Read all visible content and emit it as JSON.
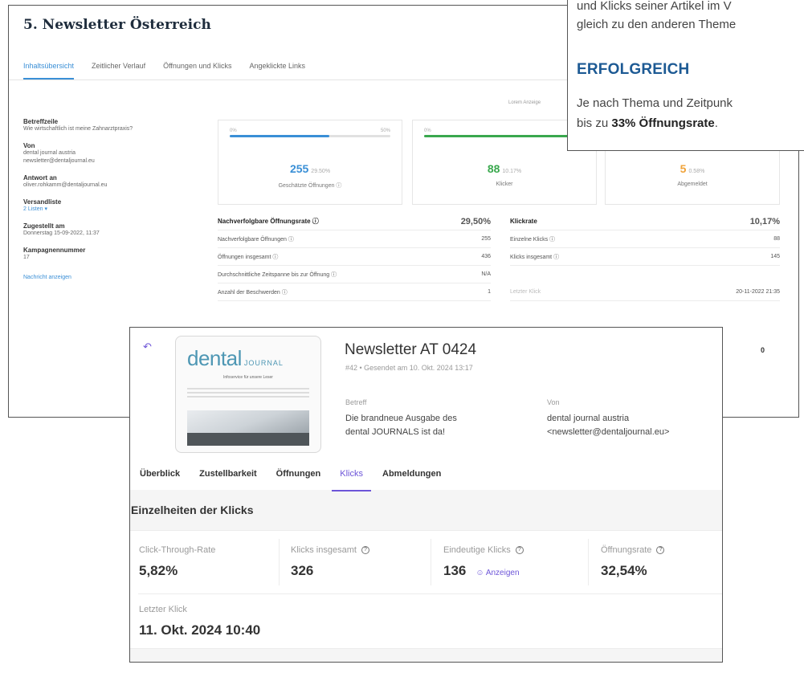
{
  "back_window": {
    "title": "5. Newsletter Österreich",
    "tabs": [
      "Inhaltsübersicht",
      "Zeitlicher Verlauf",
      "Öffnungen und Klicks",
      "Angeklickte Links"
    ],
    "top_link": "Lorem Anzeige",
    "sidebar": [
      {
        "label": "Betreffzeile",
        "value": "Wie wirtschaftlich ist meine Zahnarztpraxis?"
      },
      {
        "label": "Von",
        "value": "dental journal austria\nnewsletter@dentaljournal.eu"
      },
      {
        "label": "Antwort an",
        "value": "oliver.rohkamm@dentaljournal.eu"
      },
      {
        "label": "Versandliste",
        "value": "2 Listen ▾"
      },
      {
        "label": "Zugestellt am",
        "value": "Donnerstag 15-09-2022, 11:37"
      },
      {
        "label": "Kampagnennummer",
        "value": "17"
      }
    ],
    "sidebar_link": "Nachricht anzeigen",
    "stats": [
      {
        "value": "255",
        "pct": "29.50%",
        "caption": "Geschätzte Öffnungen ⓘ",
        "bar_start": "0%",
        "bar_end": "50%",
        "fill": 0.62,
        "color": "#3a8fd6"
      },
      {
        "value": "88",
        "pct": "10.17%",
        "caption": "Klicker",
        "bar_start": "0%",
        "bar_end": "",
        "fill": 1.0,
        "color": "#3aa84e"
      },
      {
        "value": "5",
        "pct": "0.58%",
        "caption": "Abgemeldet",
        "bar_start": "",
        "bar_end": "",
        "fill": 0,
        "color": "#f0a33a"
      }
    ],
    "open_table": {
      "header_label": "Nachverfolgbare Öffnungsrate ⓘ",
      "header_value": "29,50%",
      "rows": [
        {
          "label": "Nachverfolgbare Öffnungen ⓘ",
          "value": "255"
        },
        {
          "label": "Öffnungen insgesamt ⓘ",
          "value": "436"
        },
        {
          "label": "Durchschnittliche Zeitspanne bis zur Öffnung ⓘ",
          "value": "N/A"
        },
        {
          "label": "Anzahl der Beschwerden ⓘ",
          "value": "1"
        }
      ]
    },
    "click_table": {
      "header_label": "Klickrate",
      "header_value": "10,17%",
      "rows": [
        {
          "label": "Einzelne Klicks ⓘ",
          "value": "88"
        },
        {
          "label": "Klicks insgesamt ⓘ",
          "value": "145"
        },
        {
          "label": "",
          "value": ""
        },
        {
          "label": "Letzter Klick",
          "value": "20-11-2022 21:35"
        }
      ],
      "extra_value": "0"
    }
  },
  "article": {
    "line1": "und Klicks seiner Artikel im V",
    "line2": "gleich zu den anderen Theme",
    "heading": "ERFOLGREICH",
    "line3": "Je nach Thema und Zeitpunk",
    "line4_prefix": "bis zu ",
    "line4_bold": "33% Öffnungsrate",
    "line4_suffix": "."
  },
  "front_window": {
    "back_icon": "↶",
    "thumbnail": {
      "logo": "dental",
      "logo_suffix": "JOURNAL",
      "subtitle": "Infoservice für unsere Leser"
    },
    "title": "Newsletter AT 0424",
    "subtitle": "#42 • Gesendet am 10. Okt. 2024 13:17",
    "subject_label": "Betreff",
    "subject_value": "Die brandneue Ausgabe des\ndental JOURNALS ist da!",
    "from_label": "Von",
    "from_value": "dental journal austria\n<newsletter@dentaljournal.eu>",
    "tabs": [
      "Überblick",
      "Zustellbarkeit",
      "Öffnungen",
      "Klicks",
      "Abmeldungen"
    ],
    "active_tab": "Klicks",
    "section_title": "Einzelheiten der Klicks",
    "metrics": [
      {
        "label": "Click-Through-Rate",
        "value": "5,82%",
        "help": false
      },
      {
        "label": "Klicks insgesamt",
        "value": "326",
        "help": true
      },
      {
        "label": "Eindeutige Klicks",
        "value": "136",
        "help": true,
        "link": "Anzeigen"
      },
      {
        "label": "Öffnungsrate",
        "value": "32,54%",
        "help": true
      }
    ],
    "last_click_label": "Letzter Klick",
    "last_click_value": "11. Okt. 2024 10:40"
  },
  "colors": {
    "accent_blue": "#3a8fd6",
    "accent_purple": "#6d55d8",
    "heading_blue": "#1d5a94"
  },
  "icons": [
    "back-arrow-icon",
    "help-icon",
    "users-icon"
  ]
}
